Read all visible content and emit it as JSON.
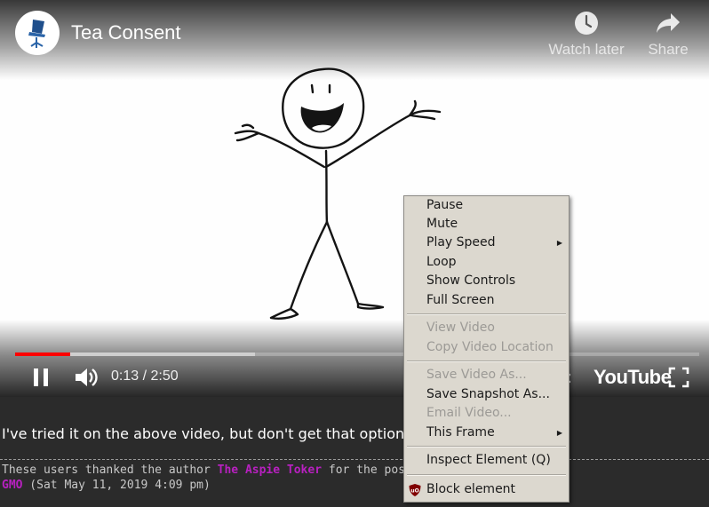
{
  "player": {
    "title": "Tea Consent",
    "watch_later_label": "Watch later",
    "share_label": "Share",
    "time_current": "0:13",
    "time_separator": " / ",
    "time_total": "2:50",
    "progress_played_fraction": 0.08,
    "progress_buffered_fraction": 0.35,
    "logo_text": "YouTube",
    "accent_color": "#ff0000"
  },
  "post": {
    "text": "I've tried it on the above video, but don't get that option."
  },
  "thanks": {
    "prefix": "These users thanked the author ",
    "author": "The Aspie Toker",
    "suffix": " for the post:",
    "user": "GMO",
    "date": " (Sat May 11, 2019 4:09 pm)"
  },
  "context_menu": {
    "items": [
      {
        "label": "Pause",
        "accel": "P",
        "enabled": true
      },
      {
        "label": "Mute",
        "accel": "M",
        "enabled": true
      },
      {
        "label": "Play Speed",
        "accel": "S",
        "enabled": true,
        "submenu": true
      },
      {
        "label": "Loop",
        "accel": "L",
        "enabled": true
      },
      {
        "label": "Show Controls",
        "accel": "C",
        "enabled": true
      },
      {
        "label": "Full Screen",
        "accel": "F",
        "enabled": true
      },
      {
        "label": "View Video",
        "accel": "i",
        "enabled": false
      },
      {
        "label": "Copy Video Location",
        "accel": "o",
        "enabled": false
      },
      {
        "label": "Save Video As...",
        "accel": "v",
        "enabled": false
      },
      {
        "label": "Save Snapshot As...",
        "accel": "h",
        "enabled": true
      },
      {
        "label": "Email Video...",
        "accel": "a",
        "enabled": false
      },
      {
        "label": "This Frame",
        "accel": "h",
        "enabled": true,
        "submenu": true
      },
      {
        "label": "Inspect Element (Q)",
        "accel": "Q",
        "enabled": true
      },
      {
        "label": "Block element",
        "accel": "",
        "enabled": true,
        "icon": "ublock-origin-icon"
      }
    ]
  }
}
